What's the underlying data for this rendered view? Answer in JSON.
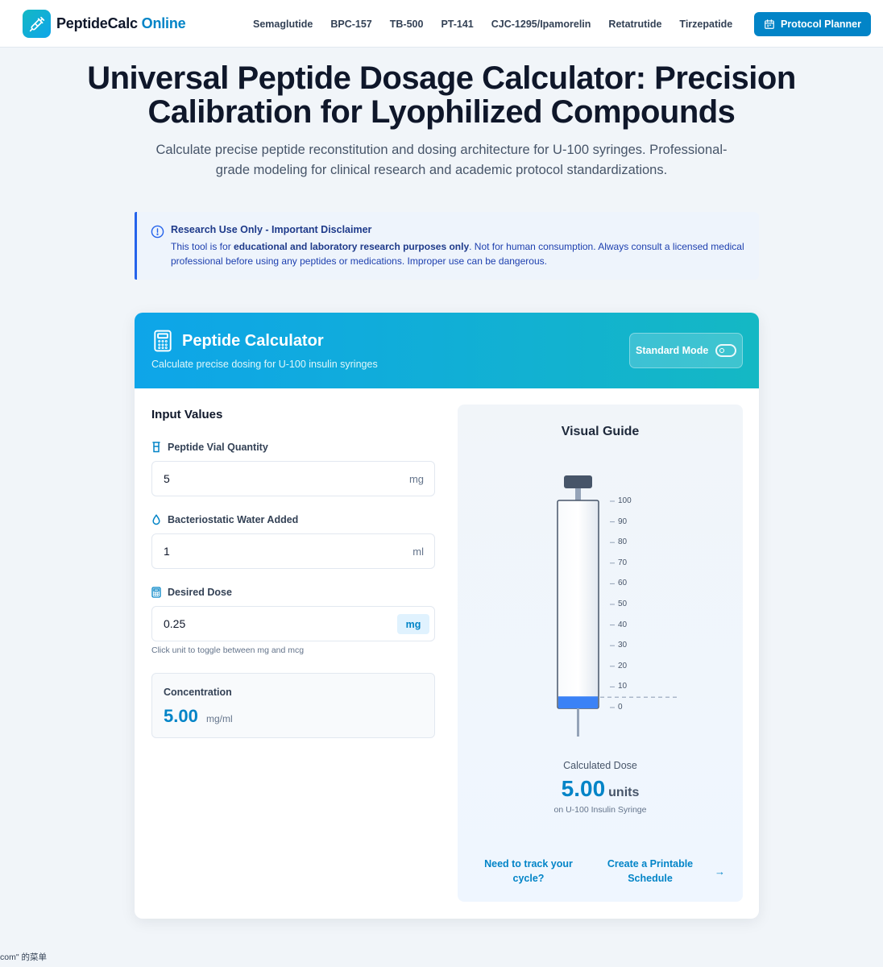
{
  "header": {
    "logo_main": "PeptideCalc",
    "logo_accent": " Online",
    "nav": [
      "Semaglutide",
      "BPC-157",
      "TB-500",
      "PT-141",
      "CJC-1295/Ipamorelin",
      "Retatrutide",
      "Tirzepatide"
    ],
    "planner_label": "Protocol Planner"
  },
  "hero": {
    "title": "Universal Peptide Dosage Calculator: Precision Calibration for Lyophilized Compounds",
    "subtitle": "Calculate precise peptide reconstitution and dosing architecture for U-100 syringes. Professional-grade modeling for clinical research and academic protocol standardizations."
  },
  "disclaimer": {
    "title": "Research Use Only - Important Disclaimer",
    "text_prefix": "This tool is for ",
    "text_bold": "educational and laboratory research purposes only",
    "text_suffix": ". Not for human consumption. Always consult a licensed medical professional before using any peptides or medications. Improper use can be dangerous."
  },
  "calculator": {
    "title": "Peptide Calculator",
    "subtitle": "Calculate precise dosing for U-100 insulin syringes",
    "mode_label": "Standard Mode",
    "mode_on": false,
    "inputs_title": "Input Values",
    "vial": {
      "label": "Peptide Vial Quantity",
      "value": "5",
      "unit": "mg"
    },
    "water": {
      "label": "Bacteriostatic Water Added",
      "value": "1",
      "unit": "ml"
    },
    "dose": {
      "label": "Desired Dose",
      "value": "0.25",
      "unit": "mg"
    },
    "hint": "Click unit to toggle between mg and mcg",
    "concentration": {
      "label": "Concentration",
      "value": "5.00",
      "unit": "mg/ml"
    }
  },
  "guide": {
    "title": "Visual Guide",
    "scale_ticks": [
      "100",
      "90",
      "80",
      "70",
      "60",
      "50",
      "40",
      "30",
      "20",
      "10",
      "0"
    ],
    "fill_units": 5,
    "result_label": "Calculated Dose",
    "result_value": "5.00",
    "result_unit": "units",
    "result_sub": "on U-100 Insulin Syringe",
    "cta_question": "Need to track your cycle?",
    "cta_link": "Create a Printable Schedule",
    "cta_arrow": "→"
  },
  "footer_note": "com\" 的菜单",
  "colors": {
    "primary": "#0284c7",
    "accent": "#14b8c4",
    "disclaimer_border": "#2563eb"
  }
}
